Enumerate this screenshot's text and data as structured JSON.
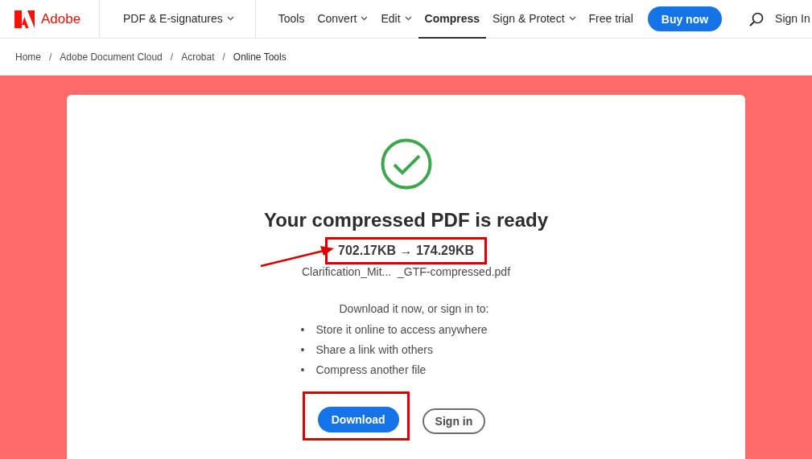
{
  "header": {
    "logo": "Adobe",
    "products_menu": {
      "label": "PDF & E-signatures",
      "dropdown": true,
      "selected": false
    },
    "nav": [
      {
        "label": "Tools",
        "dropdown": false,
        "selected": false
      },
      {
        "label": "Convert",
        "dropdown": true,
        "selected": false
      },
      {
        "label": "Edit",
        "dropdown": true,
        "selected": false
      },
      {
        "label": "Compress",
        "dropdown": false,
        "selected": true
      },
      {
        "label": "Sign & Protect",
        "dropdown": true,
        "selected": false
      },
      {
        "label": "Free trial",
        "dropdown": false,
        "selected": false
      }
    ],
    "buy_button": "Buy now",
    "sign_in": "Sign In"
  },
  "breadcrumb": [
    {
      "kind": "link",
      "text": "Home"
    },
    {
      "kind": "separator",
      "text": "/"
    },
    {
      "kind": "link",
      "text": "Adobe Document Cloud"
    },
    {
      "kind": "separator",
      "text": "/"
    },
    {
      "kind": "link",
      "text": "Acrobat"
    },
    {
      "kind": "separator",
      "text": "/"
    },
    {
      "kind": "current",
      "text": "Online Tools"
    }
  ],
  "result": {
    "title": "Your compressed PDF is ready",
    "file_size": {
      "text": "702.17KB → 174.29KB",
      "highlighted": true,
      "callout_arrow": true
    },
    "file_name": "Clarification_Mit...  _GTF-compressed.pdf",
    "intro": "Download it now, or sign in to:",
    "benefits": [
      {
        "bullet": "•",
        "text": "Store it online to access anywhere"
      },
      {
        "bullet": "•",
        "text": "Share a link with others"
      },
      {
        "bullet": "•",
        "text": "Compress another file"
      }
    ],
    "download_button": {
      "label": "Download",
      "highlighted": true
    },
    "sign_in_button": "Sign in"
  }
}
